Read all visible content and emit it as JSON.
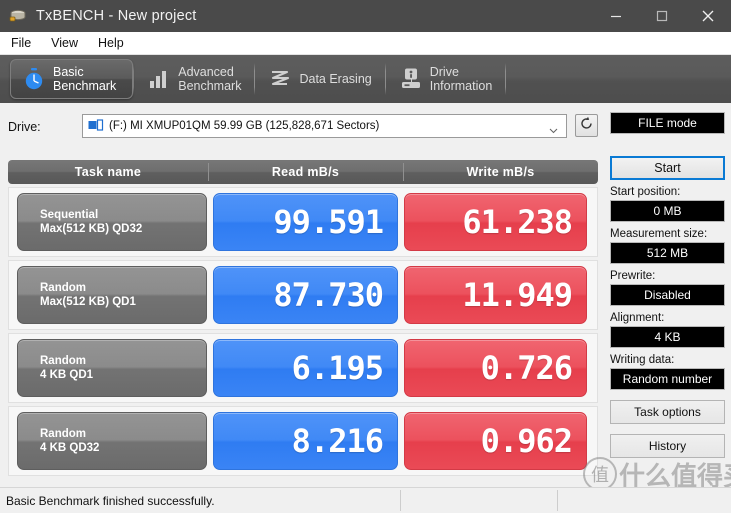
{
  "window": {
    "title": "TxBENCH - New project",
    "icon": "drive-icon",
    "minimize": "—",
    "maximize": "☐",
    "close": "✕"
  },
  "menubar": {
    "items": [
      {
        "label": "File"
      },
      {
        "label": "View"
      },
      {
        "label": "Help"
      }
    ]
  },
  "tabs": [
    {
      "label": "Basic\nBenchmark",
      "icon": "stopwatch-icon",
      "active": true
    },
    {
      "label": "Advanced\nBenchmark",
      "icon": "bar-chart-icon",
      "active": false
    },
    {
      "label": "Data Erasing",
      "icon": "eraser-wave-icon",
      "active": false
    },
    {
      "label": "Drive\nInformation",
      "icon": "drive-info-icon",
      "active": false
    }
  ],
  "drive": {
    "label": "Drive:",
    "selected": "(F:) MI XMUP01QM  59.99 GB (125,828,671 Sectors)",
    "icon": "drive-small-icon",
    "dropdown_icon": "chevron-down-icon",
    "refresh_icon": "refresh-icon"
  },
  "results": {
    "columns": [
      "Task name",
      "Read mB/s",
      "Write mB/s"
    ],
    "rows": [
      {
        "name_line1": "Sequential",
        "name_line2": "Max(512 KB) QD32",
        "read": "99.591",
        "write": "61.238"
      },
      {
        "name_line1": "Random",
        "name_line2": "Max(512 KB) QD1",
        "read": "87.730",
        "write": "11.949"
      },
      {
        "name_line1": "Random",
        "name_line2": "4 KB QD1",
        "read": "6.195",
        "write": "0.726"
      },
      {
        "name_line1": "Random",
        "name_line2": "4 KB QD32",
        "read": "8.216",
        "write": "0.962"
      }
    ]
  },
  "side": {
    "mode": "FILE mode",
    "start": "Start",
    "start_position_label": "Start position:",
    "start_position_value": "0 MB",
    "measurement_size_label": "Measurement size:",
    "measurement_size_value": "512 MB",
    "prewrite_label": "Prewrite:",
    "prewrite_value": "Disabled",
    "alignment_label": "Alignment:",
    "alignment_value": "4 KB",
    "writing_data_label": "Writing data:",
    "writing_data_value": "Random number",
    "task_options": "Task options",
    "history": "History"
  },
  "statusbar": {
    "message": "Basic Benchmark finished successfully.",
    "segment2": "",
    "segment3": ""
  },
  "watermark": {
    "mark": "值",
    "text": "什么值得买"
  },
  "colors": {
    "read_accent": "#3a84f5",
    "write_accent": "#ea4a56",
    "task_gray": "#8b8b8b",
    "titlebar": "#4a4a4a",
    "start_border": "#0a7ad4"
  }
}
